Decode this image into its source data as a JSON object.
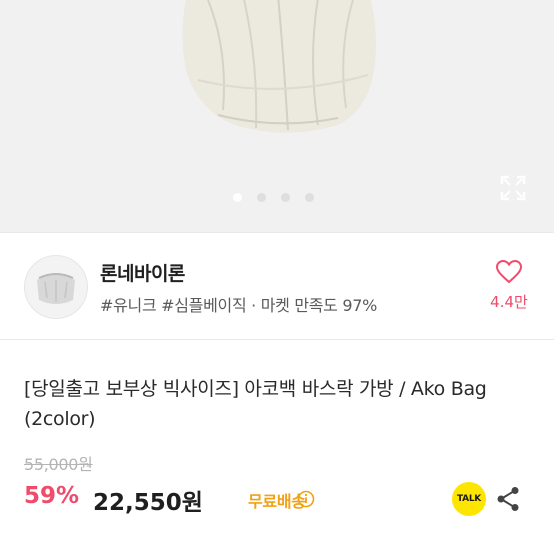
{
  "hero": {
    "image_desc": "ivory gathered pouch bag",
    "dots_total": 4,
    "dots_active": 0,
    "expand_icon": "expand-icon"
  },
  "store": {
    "name": "론네바이론",
    "tags": "#유니크 #심플베이직 · 마켓 만족도 97%",
    "likes": "4.4만",
    "heart_icon": "heart-icon"
  },
  "product": {
    "title": "[당일출고 보부상 빅사이즈] 아코백 바스락 가방 / Ako Bag (2color)",
    "original_price": "55,000원",
    "discount": "59%",
    "price": "22,550원",
    "shipping": "무료배송",
    "talk_label": "TALK"
  },
  "colors": {
    "accent_pink": "#ef4b6b",
    "shipping_orange": "#f1a116",
    "talk_yellow": "#fee500"
  }
}
